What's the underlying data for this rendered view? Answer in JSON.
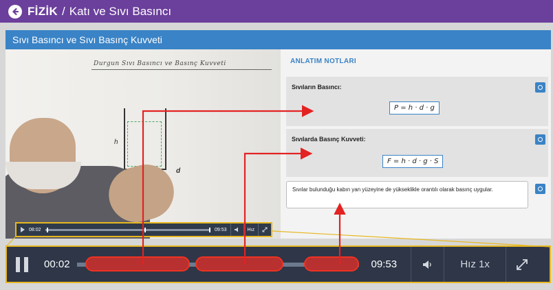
{
  "header": {
    "subject": "FİZİK",
    "separator": "/",
    "topic": "Katı ve Sıvı Basıncı"
  },
  "lesson": {
    "title": "Sıvı Basıncı ve Sıvı Basınç Kuvveti"
  },
  "video": {
    "board_title": "Durgun Sıvı Basıncı ve Basınç Kuvveti",
    "board_h_mark": "h",
    "board_d_mark": "d",
    "mini_player": {
      "current_time": "08:02",
      "total_time": "09:53",
      "speed_label": "Hız"
    }
  },
  "notes": {
    "title": "ANLATIM NOTLARI",
    "cards": [
      {
        "label": "Sıvıların Basıncı:",
        "formula": "P = h · d · g"
      },
      {
        "label": "Sıvılarda Basınç Kuvveti:",
        "formula": "F = h · d · g · S"
      }
    ],
    "callout": "Sıvılar bulunduğu kabın yan yüzeyine de yükseklikle orantılı olarak basınç uygular."
  },
  "player": {
    "current_time": "00:02",
    "total_time": "09:53",
    "speed_label": "Hız 1x"
  },
  "icons": {
    "back": "back-arrow-icon",
    "pause": "pause-icon",
    "volume": "volume-icon",
    "fullscreen": "fullscreen-icon",
    "note_toggle": "note-toggle-icon"
  },
  "colors": {
    "header_bg": "#6b3f9c",
    "lesson_bar_bg": "#3a83c6",
    "player_bg": "#2e3648",
    "highlight_border": "#e8b820",
    "annotation_red": "#e32222"
  }
}
